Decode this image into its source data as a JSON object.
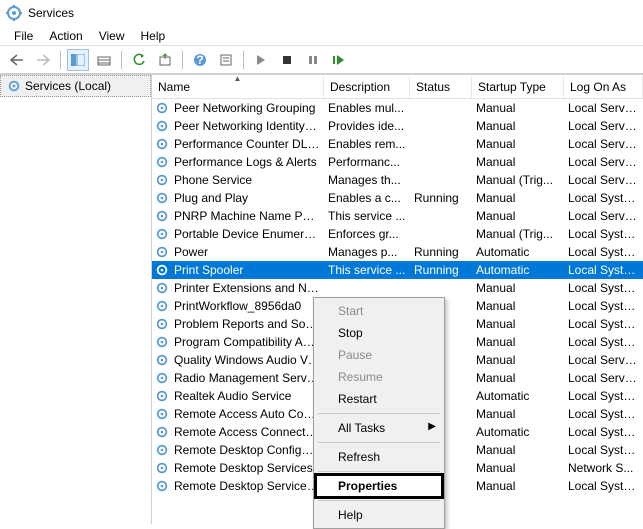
{
  "window": {
    "title": "Services"
  },
  "menu": {
    "file": "File",
    "action": "Action",
    "view": "View",
    "help": "Help"
  },
  "sidebar": {
    "label": "Services (Local)"
  },
  "columns": {
    "name": "Name",
    "description": "Description",
    "status": "Status",
    "startup": "Startup Type",
    "logon": "Log On As"
  },
  "rows": [
    {
      "name": "Peer Networking Grouping",
      "desc": "Enables mul...",
      "status": "",
      "startup": "Manual",
      "logon": "Local Service"
    },
    {
      "name": "Peer Networking Identity M...",
      "desc": "Provides ide...",
      "status": "",
      "startup": "Manual",
      "logon": "Local Service"
    },
    {
      "name": "Performance Counter DLL ...",
      "desc": "Enables rem...",
      "status": "",
      "startup": "Manual",
      "logon": "Local Service"
    },
    {
      "name": "Performance Logs & Alerts",
      "desc": "Performanc...",
      "status": "",
      "startup": "Manual",
      "logon": "Local Service"
    },
    {
      "name": "Phone Service",
      "desc": "Manages th...",
      "status": "",
      "startup": "Manual (Trig...",
      "logon": "Local Service"
    },
    {
      "name": "Plug and Play",
      "desc": "Enables a c...",
      "status": "Running",
      "startup": "Manual",
      "logon": "Local Syste..."
    },
    {
      "name": "PNRP Machine Name Publi...",
      "desc": "This service ...",
      "status": "",
      "startup": "Manual",
      "logon": "Local Service"
    },
    {
      "name": "Portable Device Enumerator...",
      "desc": "Enforces gr...",
      "status": "",
      "startup": "Manual (Trig...",
      "logon": "Local Syste..."
    },
    {
      "name": "Power",
      "desc": "Manages p...",
      "status": "Running",
      "startup": "Automatic",
      "logon": "Local Syste..."
    },
    {
      "name": "Print Spooler",
      "desc": "This service ...",
      "status": "Running",
      "startup": "Automatic",
      "logon": "Local Syste...",
      "selected": true
    },
    {
      "name": "Printer Extensions and Notif...",
      "desc": "",
      "status": "",
      "startup": "Manual",
      "logon": "Local Syste..."
    },
    {
      "name": "PrintWorkflow_8956da0",
      "desc": "",
      "status": "",
      "startup": "Manual",
      "logon": "Local Syste..."
    },
    {
      "name": "Problem Reports and Soluti...",
      "desc": "",
      "status": "",
      "startup": "Manual",
      "logon": "Local Syste..."
    },
    {
      "name": "Program Compatibility Assi...",
      "desc": "",
      "status": "",
      "startup": "Manual",
      "logon": "Local Syste..."
    },
    {
      "name": "Quality Windows Audio Vid...",
      "desc": "",
      "status": "",
      "startup": "Manual",
      "logon": "Local Service"
    },
    {
      "name": "Radio Management Service",
      "desc": "",
      "status": "",
      "startup": "Manual",
      "logon": "Local Service"
    },
    {
      "name": "Realtek Audio Service",
      "desc": "",
      "status": "",
      "startup": "Automatic",
      "logon": "Local Syste..."
    },
    {
      "name": "Remote Access Auto Conne...",
      "desc": "",
      "status": "",
      "startup": "Manual",
      "logon": "Local Syste..."
    },
    {
      "name": "Remote Access Connection...",
      "desc": "",
      "status": "",
      "startup": "Automatic",
      "logon": "Local Syste..."
    },
    {
      "name": "Remote Desktop Configurat...",
      "desc": "",
      "status": "",
      "startup": "Manual",
      "logon": "Local Syste..."
    },
    {
      "name": "Remote Desktop Services",
      "desc": "",
      "status": "",
      "startup": "Manual",
      "logon": "Network S..."
    },
    {
      "name": "Remote Desktop Services U...",
      "desc": "",
      "status": "",
      "startup": "Manual",
      "logon": "Local Syste..."
    }
  ],
  "context_menu": {
    "start": "Start",
    "stop": "Stop",
    "pause": "Pause",
    "resume": "Resume",
    "restart": "Restart",
    "all_tasks": "All Tasks",
    "refresh": "Refresh",
    "properties": "Properties",
    "help": "Help"
  }
}
